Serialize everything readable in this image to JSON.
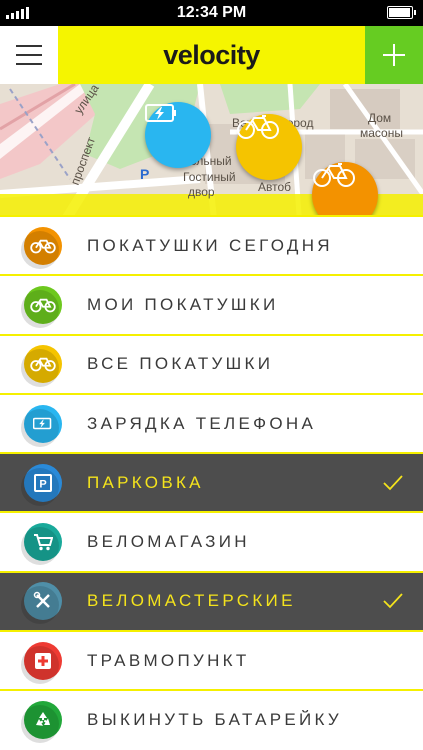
{
  "status_bar": {
    "time": "12:34 PM"
  },
  "header": {
    "title": "velocity",
    "menu_icon": "hamburger-menu-icon",
    "add_icon": "plus-icon",
    "colors": {
      "header_bg": "#f5f500",
      "add_bg": "#66cc22"
    }
  },
  "map": {
    "labels": [
      "улица",
      "проспект",
      "Верхний город",
      "Дом",
      "масоны",
      "ольный",
      "Гостиный",
      "двор",
      "Автоб"
    ],
    "markers": [
      {
        "icon": "phone-charging-icon",
        "color": "#29b6f0"
      },
      {
        "icon": "bicycle-icon",
        "color": "#f5c400"
      },
      {
        "icon": "bicycle-icon",
        "color": "#f39200"
      }
    ]
  },
  "menu": {
    "items": [
      {
        "label": "ПОКАТУШКИ СЕГОДНЯ",
        "icon": "bicycle-icon",
        "color": "#f39200",
        "selected": false
      },
      {
        "label": "МОИ ПОКАТУШКИ",
        "icon": "bicycle-icon",
        "color": "#6dc81e",
        "selected": false
      },
      {
        "label": "ВСЕ ПОКАТУШКИ",
        "icon": "bicycle-icon",
        "color": "#f5c400",
        "selected": false
      },
      {
        "label": "ЗАРЯДКА ТЕЛЕФОНА",
        "icon": "phone-charging-icon",
        "color": "#29b6f0",
        "selected": false
      },
      {
        "label": "ПАРКОВКА",
        "icon": "parking-icon",
        "color": "#2a8ad8",
        "selected": true
      },
      {
        "label": "ВЕЛОМАГАЗИН",
        "icon": "shopping-cart-icon",
        "color": "#19a99a",
        "selected": false
      },
      {
        "label": "ВЕЛОМАСТЕРСКИЕ",
        "icon": "repair-tools-icon",
        "color": "#4f8fa8",
        "selected": true
      },
      {
        "label": "ТРАВМОПУНКТ",
        "icon": "first-aid-icon",
        "color": "#ee3b33",
        "selected": false
      },
      {
        "label": "ВЫКИНУТЬ БАТАРЕЙКУ",
        "icon": "recycle-icon",
        "color": "#22a83a",
        "selected": false
      }
    ]
  }
}
